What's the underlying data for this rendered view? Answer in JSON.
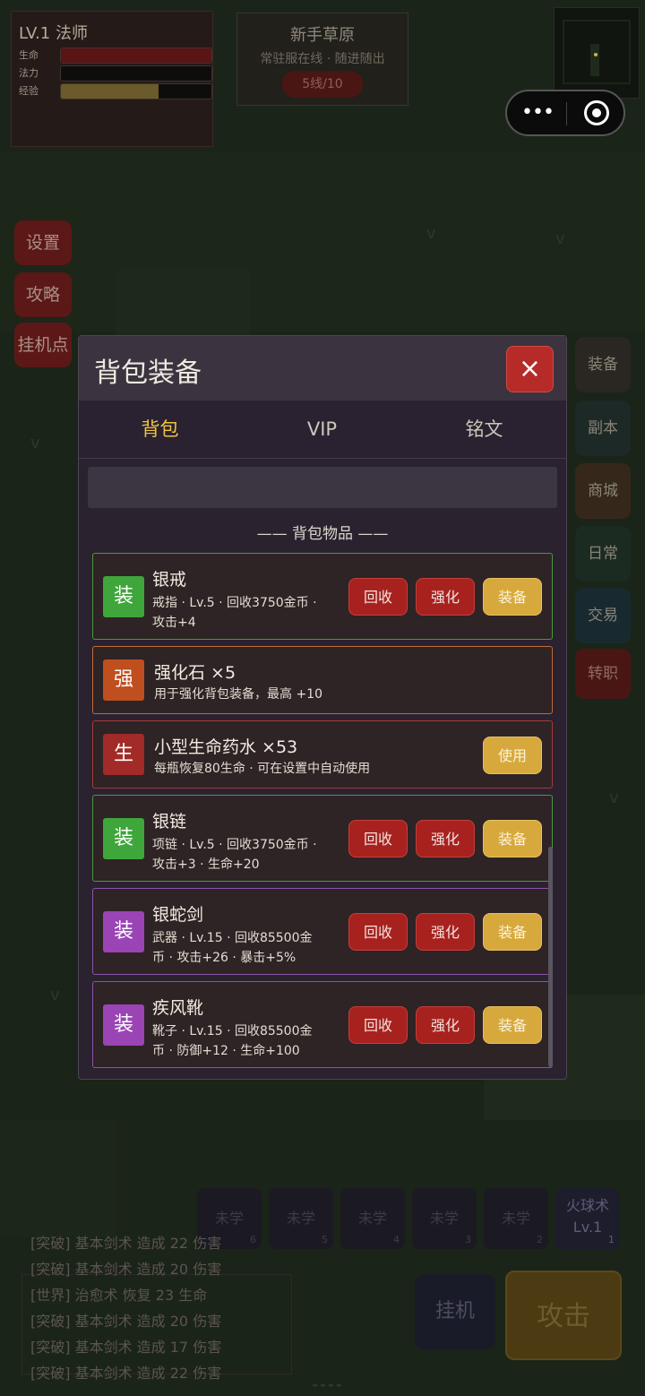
{
  "player": {
    "title": "LV.1 法师",
    "hp_label": "生命",
    "mp_label": "法力",
    "exp_label": "经验",
    "hp_fraction": 1.0,
    "mp_fraction": 0.0,
    "exp_fraction": 0.65,
    "colors": {
      "hp": "#5a1414",
      "mp": "#1a1718",
      "exp": "#6b5a2a"
    }
  },
  "zone": {
    "name": "新手草原",
    "subtitle": "常驻服在线 · 随进随出",
    "line": "5线/10"
  },
  "side_left": [
    "设置",
    "攻略",
    "挂机点"
  ],
  "side_right": [
    "装备",
    "副本",
    "商城",
    "日常",
    "交易",
    "转职"
  ],
  "modal": {
    "title": "背包装备",
    "close": "×",
    "tabs": [
      "背包",
      "VIP",
      "铭文"
    ],
    "active_tab": "背包",
    "section_title": "—— 背包物品 ——",
    "items": [
      {
        "badge": "装",
        "badge_color": "#3ea63a",
        "border_color": "#4a9a3e",
        "name": "银戒",
        "desc1": "戒指 · Lv.5 · 回收3750金币 ·",
        "desc2": "攻击+4",
        "btn1": "回收",
        "btn2": "强化",
        "btn3": "装备"
      },
      {
        "badge": "强",
        "badge_color": "#bf4f1f",
        "border_color": "#c26a35",
        "name": "强化石 ×5",
        "desc1": "用于强化背包装备，最高 +10"
      },
      {
        "badge": "生",
        "badge_color": "#a22a27",
        "border_color": "#a43a35",
        "name": "小型生命药水 ×53",
        "desc1": "每瓶恢复80生命 · 可在设置中自动使用",
        "btn3": "使用"
      },
      {
        "badge": "装",
        "badge_color": "#3ea63a",
        "border_color": "#4a9a3e",
        "name": "银链",
        "desc1": "项链 · Lv.5 · 回收3750金币 ·",
        "desc2": "攻击+3 · 生命+20",
        "btn1": "回收",
        "btn2": "强化",
        "btn3": "装备"
      },
      {
        "badge": "装",
        "badge_color": "#9a44b5",
        "border_color": "#8a54a8",
        "name": "银蛇剑",
        "desc1": "武器 · Lv.15 · 回收85500金",
        "desc2": "币 · 攻击+26 · 暴击+5%",
        "btn1": "回收",
        "btn2": "强化",
        "btn3": "装备"
      },
      {
        "badge": "装",
        "badge_color": "#9a44b5",
        "border_color": "#8a54a8",
        "name": "疾风靴",
        "desc1": "靴子 · Lv.15 · 回收85500金",
        "desc2": "币 · 防御+12 · 生命+100",
        "btn1": "回收",
        "btn2": "强化",
        "btn3": "装备"
      }
    ]
  },
  "skills": [
    {
      "name": "未学",
      "num": "6"
    },
    {
      "name": "未学",
      "num": "5"
    },
    {
      "name": "未学",
      "num": "4"
    },
    {
      "name": "未学",
      "num": "3"
    },
    {
      "name": "未学",
      "num": "2"
    },
    {
      "name": "火球术\nLv.1",
      "num": "1"
    }
  ],
  "log": [
    "[突破] 基本剑术 造成 22 伤害",
    "[突破] 基本剑术 造成 20 伤害",
    "[世界] 治愈术 恢复 23 生命",
    "[突破] 基本剑术 造成 20 伤害",
    "[突破] 基本剑术 造成 17 伤害",
    "[突破] 基本剑术 造成 22 伤害"
  ],
  "hangup_label": "挂机",
  "attack_label": "攻击"
}
